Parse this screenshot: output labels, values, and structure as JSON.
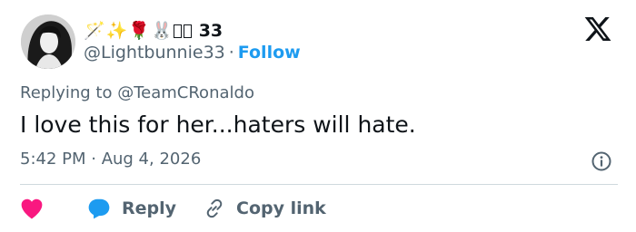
{
  "author": {
    "display_name_emojis": [
      "🪄",
      "✨",
      "🌹",
      "🐰"
    ],
    "display_name_suffix": "33",
    "handle": "@Lightbunnie33",
    "separator": "·",
    "follow_label": "Follow"
  },
  "tweet": {
    "replying_prefix": "Replying to",
    "replying_to": "@TeamCRonaldo",
    "text": "I love this for her...haters will hate.",
    "timestamp": "5:42 PM · Aug 4, 2026"
  },
  "actions": {
    "reply_label": "Reply",
    "copy_link_label": "Copy link"
  },
  "colors": {
    "accent": "#1d9bf0",
    "heart": "#f91880",
    "secondary_text": "#536471",
    "divider": "#cfd9de"
  },
  "icons": {
    "brand": "x-logo-icon",
    "heart": "heart-icon",
    "reply": "speech-bubble-icon",
    "copy_link": "link-icon",
    "info": "info-icon"
  }
}
